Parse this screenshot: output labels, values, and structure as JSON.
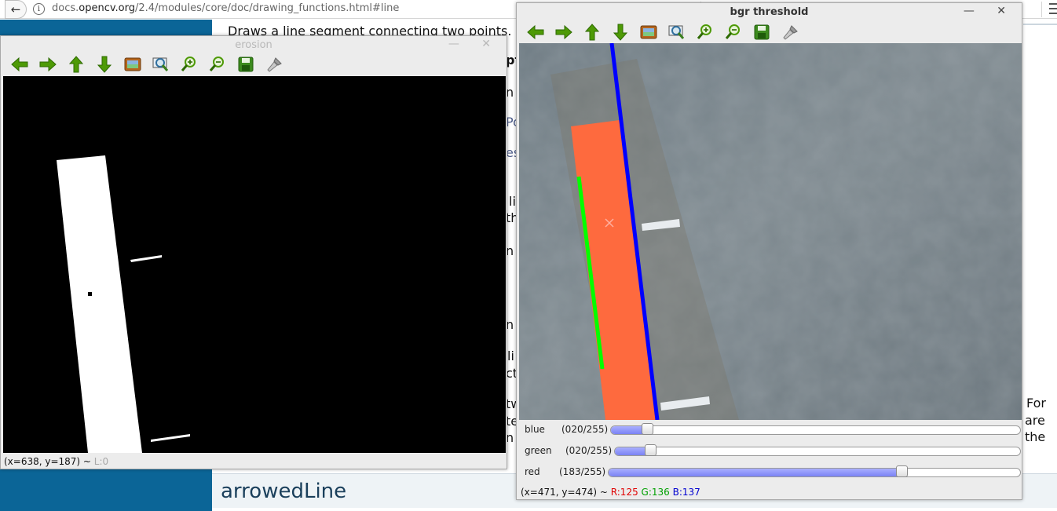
{
  "browser": {
    "back_icon": "arrow-left-icon",
    "info_icon": "info-icon",
    "info_glyph": "i",
    "url_pre": "docs.",
    "url_domain": "opencv.org",
    "url_path": "/2.4/modules/core/doc/drawing_functions.html#line"
  },
  "doc": {
    "intro": "Draws a line segment connecting two points.",
    "fragments": {
      "f1": "pt",
      "f2": "n",
      "f3": "Po",
      "f4": "es",
      "f5": "li",
      "f6": "th",
      "f7": "n",
      "f8": "n",
      "f9": "li",
      "f10": "ct",
      "f11": "tw",
      "f12": "te",
      "f13": "n"
    },
    "right_col": [
      "For",
      "are",
      "the"
    ],
    "heading": "arrowedLine",
    "sidebar_color": "#0b6597"
  },
  "erosion_window": {
    "title": "erosion",
    "close_glyph": "—  ✕",
    "toolbar": [
      "pan-left-icon",
      "pan-right-icon",
      "pan-up-icon",
      "pan-down-icon",
      "zoom-original-icon",
      "zoom-fit-icon",
      "zoom-in-icon",
      "zoom-out-icon",
      "save-icon",
      "properties-icon"
    ],
    "status": "(x=638, y=187) ~ ",
    "status_level": "L:0"
  },
  "bgr_window": {
    "title": "bgr threshold",
    "close_glyph": "—  ✕",
    "toolbar": [
      "pan-left-icon",
      "pan-right-icon",
      "pan-up-icon",
      "pan-down-icon",
      "zoom-original-icon",
      "zoom-fit-icon",
      "zoom-in-icon",
      "zoom-out-icon",
      "save-icon",
      "properties-icon"
    ],
    "trackbars": [
      {
        "name": "blue",
        "display": "(020/255)",
        "value": 20,
        "max": 255
      },
      {
        "name": "green",
        "display": "(020/255)",
        "value": 20,
        "max": 255
      },
      {
        "name": "red",
        "display": "(183/255)",
        "value": 183,
        "max": 255
      }
    ],
    "status": {
      "coords": "(x=471, y=474) ~ ",
      "r": "R:125",
      "g": "G:136",
      "b": "B:137",
      "r_color": "#e00000",
      "g_color": "#00a000",
      "b_color": "#0000d0"
    },
    "overlay_colors": {
      "rect": "#fe6a3e",
      "blue_line": "#0000ff",
      "green_line": "#00ff00",
      "marker": "#ffb0a0"
    }
  }
}
